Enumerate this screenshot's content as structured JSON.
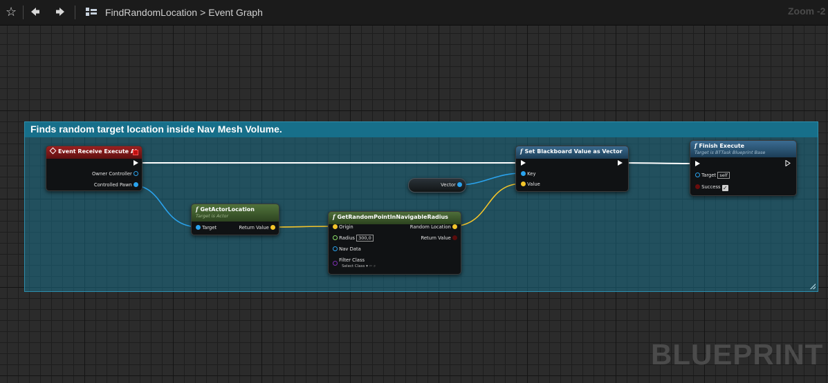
{
  "toolbar": {
    "asset_name": "FindRandomLocation",
    "graph_name": "Event Graph",
    "zoom_label": "Zoom -2"
  },
  "comment": {
    "title": "Finds random target location inside Nav Mesh Volume."
  },
  "nodes": {
    "event_execute": {
      "title": "Event Receive Execute AI",
      "pins": [
        "Owner Controller",
        "Controlled Pawn"
      ]
    },
    "get_actor_location": {
      "title": "GetActorLocation",
      "subtitle": "Target is Actor",
      "pins": [
        "Target",
        "Return Value"
      ]
    },
    "get_random_point": {
      "title": "GetRandomPointInNavigableRadius",
      "pins": [
        "Origin",
        "Radius",
        "Nav Data",
        "Filter Class",
        "Random Location",
        "Return Value"
      ],
      "radius_value": "300,0",
      "filter_class_value": "Select Class"
    },
    "vector_var": {
      "label": "Vector"
    },
    "set_bb_value": {
      "title": "Set Blackboard Value as Vector",
      "pins": [
        "Key",
        "Value"
      ]
    },
    "finish_execute": {
      "title": "Finish Execute",
      "subtitle": "Target is BTTask Blueprint Base",
      "pins": [
        "Target",
        "Success"
      ],
      "target_value": "self"
    }
  },
  "watermark": "BLUEPRINT",
  "colors": {
    "comment": "#1a7a96",
    "event_header": "#8b1c1c",
    "pure_function_header": "#3d5a2e",
    "function_header": "#2b5a78",
    "vector_pin": "#f4c52a",
    "object_pin": "#2aa3ee",
    "exec_wire": "#ffffff"
  },
  "icons": [
    "star-icon",
    "back-arrow-icon",
    "forward-arrow-icon",
    "blueprint-graph-icon",
    "chevron-right-icon",
    "event-diamond-icon",
    "function-icon",
    "checkbox-checked-icon",
    "magnifier-icon"
  ]
}
